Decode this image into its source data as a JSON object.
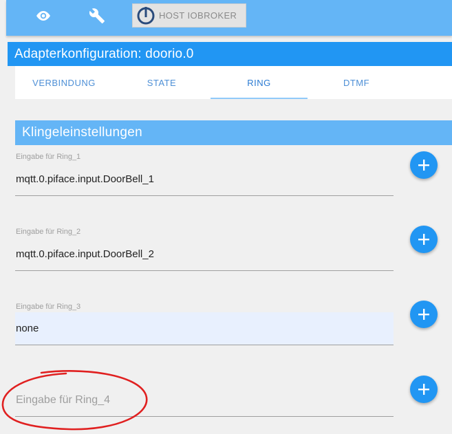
{
  "host": {
    "label": "HOST IOBROKER"
  },
  "title": "Adapterkonfiguration: doorio.0",
  "tabs": [
    {
      "label": "VERBINDUNG"
    },
    {
      "label": "STATE"
    },
    {
      "label": "RING"
    },
    {
      "label": "DTMF"
    }
  ],
  "active_tab": "RING",
  "section": {
    "title": "Klingeleinstellungen"
  },
  "fields": [
    {
      "label": "Eingabe für Ring_1",
      "value": "mqtt.0.piface.input.DoorBell_1"
    },
    {
      "label": "Eingabe für Ring_2",
      "value": "mqtt.0.piface.input.DoorBell_2"
    },
    {
      "label": "Eingabe für Ring_3",
      "value": "none"
    },
    {
      "placeholder": "Eingabe für Ring_4"
    }
  ],
  "colors": {
    "toolbar": "#64b5f6",
    "title_bar": "#2196f3",
    "accent": "#2196f3",
    "annotation": "#e02020"
  },
  "icons": {
    "toolbar": [
      "eye-icon",
      "wrench-icon"
    ],
    "host": "iobroker-logo-icon",
    "add": "plus-icon"
  }
}
